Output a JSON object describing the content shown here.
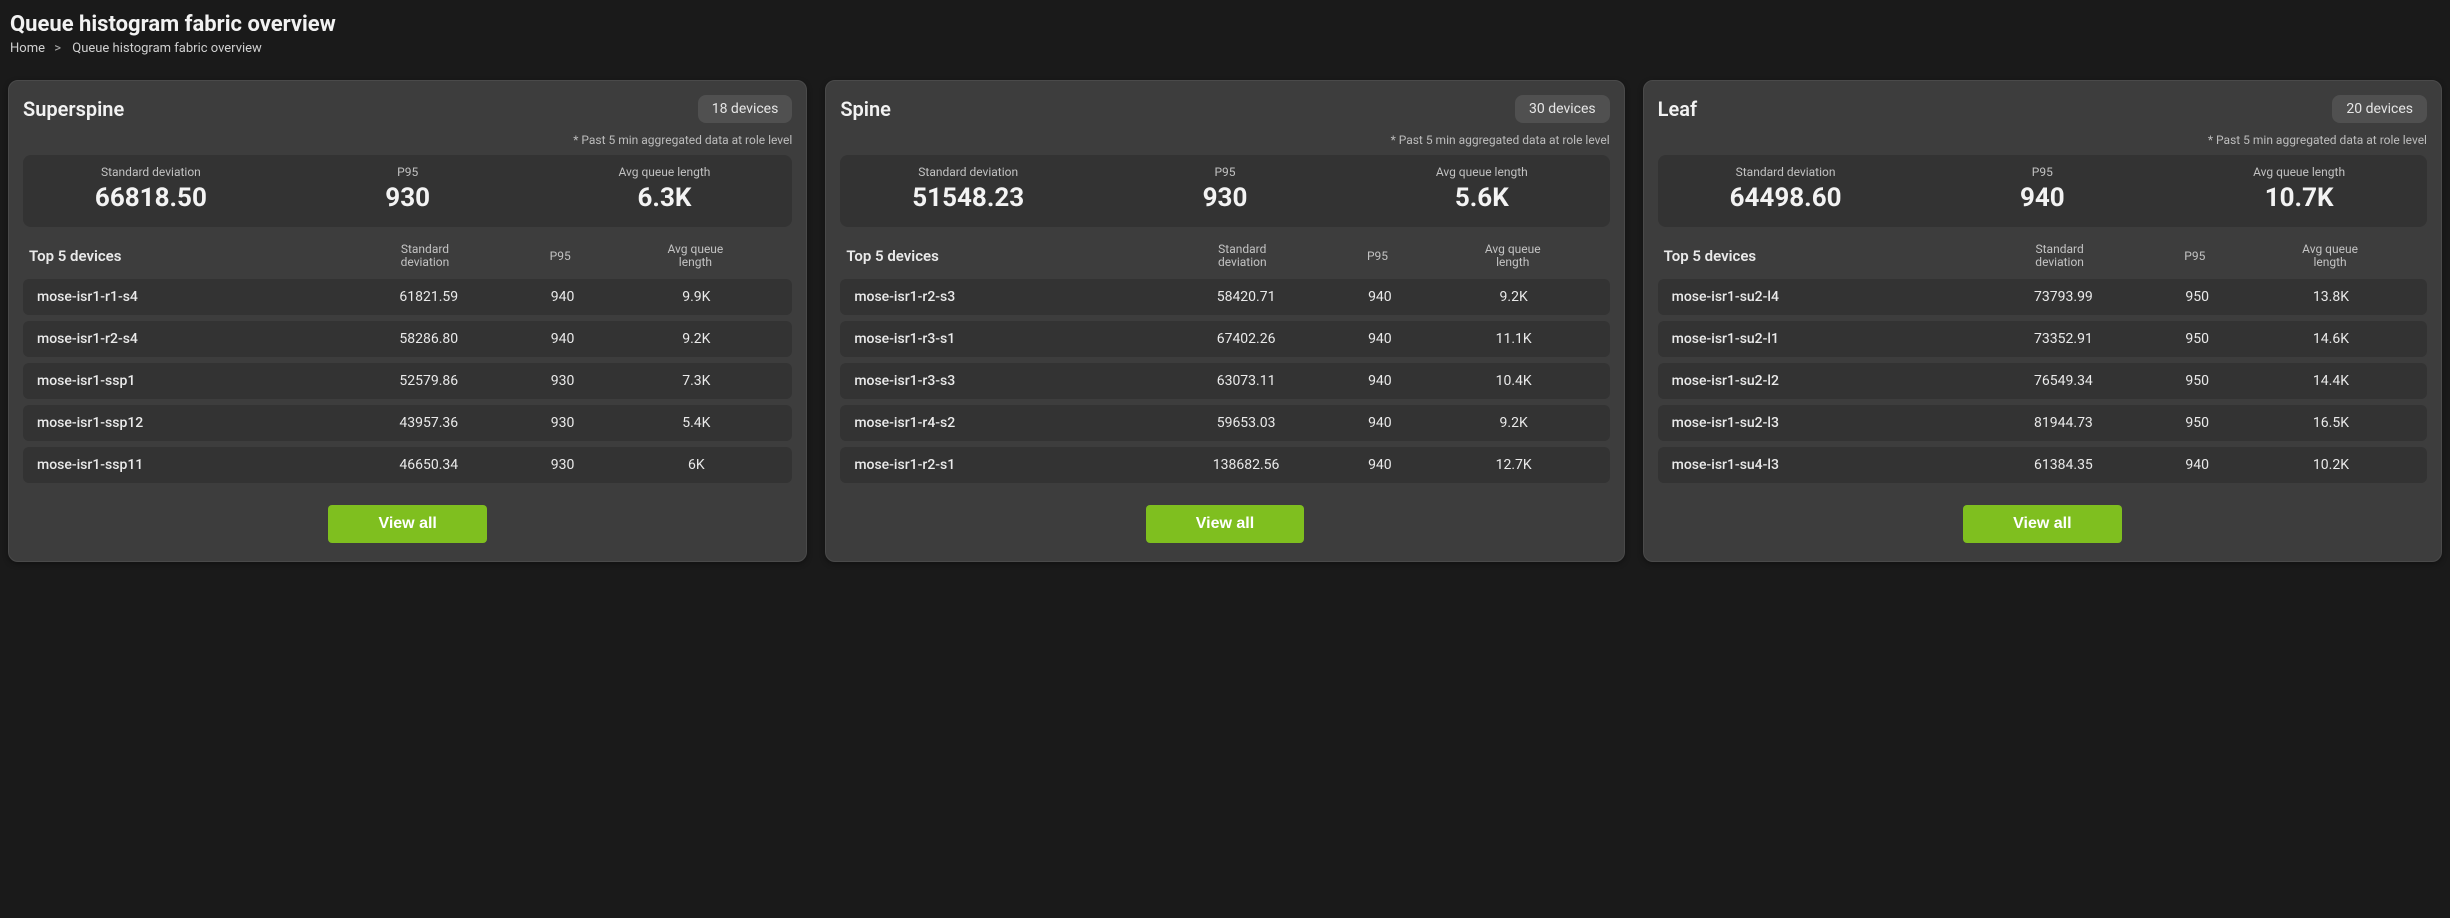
{
  "page": {
    "title": "Queue histogram fabric overview",
    "breadcrumb": [
      "Home",
      "Queue histogram fabric overview"
    ],
    "note": "* Past 5 min aggregated data at role level",
    "labels": {
      "std": "Standard deviation",
      "p95": "P95",
      "avgq": "Avg queue length",
      "top5": "Top 5 devices",
      "viewall": "View all",
      "devices_suffix": "devices"
    }
  },
  "cards": [
    {
      "id": "superspine",
      "title": "Superspine",
      "device_count": "18",
      "stats": {
        "std": "66818.50",
        "p95": "930",
        "avgq": "6.3K"
      },
      "rows": [
        {
          "name": "mose-isr1-r1-s4",
          "std": "61821.59",
          "p95": "940",
          "avgq": "9.9K"
        },
        {
          "name": "mose-isr1-r2-s4",
          "std": "58286.80",
          "p95": "940",
          "avgq": "9.2K"
        },
        {
          "name": "mose-isr1-ssp1",
          "std": "52579.86",
          "p95": "930",
          "avgq": "7.3K"
        },
        {
          "name": "mose-isr1-ssp12",
          "std": "43957.36",
          "p95": "930",
          "avgq": "5.4K"
        },
        {
          "name": "mose-isr1-ssp11",
          "std": "46650.34",
          "p95": "930",
          "avgq": "6K"
        }
      ]
    },
    {
      "id": "spine",
      "title": "Spine",
      "device_count": "30",
      "stats": {
        "std": "51548.23",
        "p95": "930",
        "avgq": "5.6K"
      },
      "rows": [
        {
          "name": "mose-isr1-r2-s3",
          "std": "58420.71",
          "p95": "940",
          "avgq": "9.2K"
        },
        {
          "name": "mose-isr1-r3-s1",
          "std": "67402.26",
          "p95": "940",
          "avgq": "11.1K"
        },
        {
          "name": "mose-isr1-r3-s3",
          "std": "63073.11",
          "p95": "940",
          "avgq": "10.4K"
        },
        {
          "name": "mose-isr1-r4-s2",
          "std": "59653.03",
          "p95": "940",
          "avgq": "9.2K"
        },
        {
          "name": "mose-isr1-r2-s1",
          "std": "138682.56",
          "p95": "940",
          "avgq": "12.7K"
        }
      ]
    },
    {
      "id": "leaf",
      "title": "Leaf",
      "device_count": "20",
      "stats": {
        "std": "64498.60",
        "p95": "940",
        "avgq": "10.7K"
      },
      "rows": [
        {
          "name": "mose-isr1-su2-l4",
          "std": "73793.99",
          "p95": "950",
          "avgq": "13.8K"
        },
        {
          "name": "mose-isr1-su2-l1",
          "std": "73352.91",
          "p95": "950",
          "avgq": "14.6K"
        },
        {
          "name": "mose-isr1-su2-l2",
          "std": "76549.34",
          "p95": "950",
          "avgq": "14.4K"
        },
        {
          "name": "mose-isr1-su2-l3",
          "std": "81944.73",
          "p95": "950",
          "avgq": "16.5K"
        },
        {
          "name": "mose-isr1-su4-l3",
          "std": "61384.35",
          "p95": "940",
          "avgq": "10.2K"
        }
      ]
    }
  ]
}
